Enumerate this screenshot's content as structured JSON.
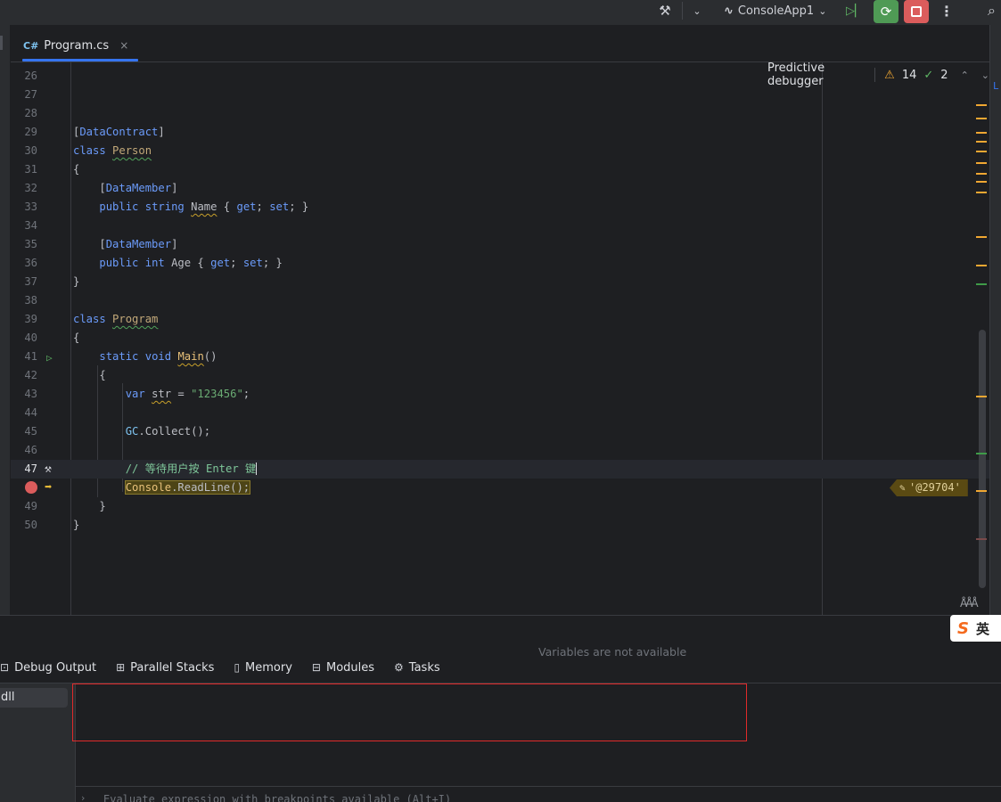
{
  "toolbar": {
    "run_config": "ConsoleApp1"
  },
  "tab": {
    "lang_badge": "C#",
    "file_name": "Program.cs",
    "close_glyph": "×"
  },
  "predictive": {
    "label": "Predictive debugger",
    "warnings": "14",
    "checks": "2"
  },
  "editor": {
    "line_numbers": [
      "26",
      "27",
      "28",
      "29",
      "30",
      "31",
      "32",
      "33",
      "34",
      "35",
      "36",
      "37",
      "38",
      "39",
      "40",
      "41",
      "42",
      "43",
      "44",
      "45",
      "46",
      "47",
      "",
      "49",
      "50"
    ],
    "current_line": "47",
    "comment_text": "// 等待用户按 Enter 键",
    "inline_value": "'@29704'"
  },
  "debug_panel": {
    "tabs": [
      "Debug Output",
      "Parallel Stacks",
      "Memory",
      "Modules",
      "Tasks"
    ],
    "frame_item": "dll",
    "vars_message": "Variables are not available",
    "eval_placeholder": "Evaluate expression with breakpoints available (Alt+I)"
  },
  "ime": {
    "lang": "英"
  },
  "colors": {
    "accent": "#3574f0",
    "resume_green": "#5fb865",
    "stop_red": "#db5c5c",
    "highlight_box": "#e02a2a",
    "warning": "#f0a732"
  }
}
